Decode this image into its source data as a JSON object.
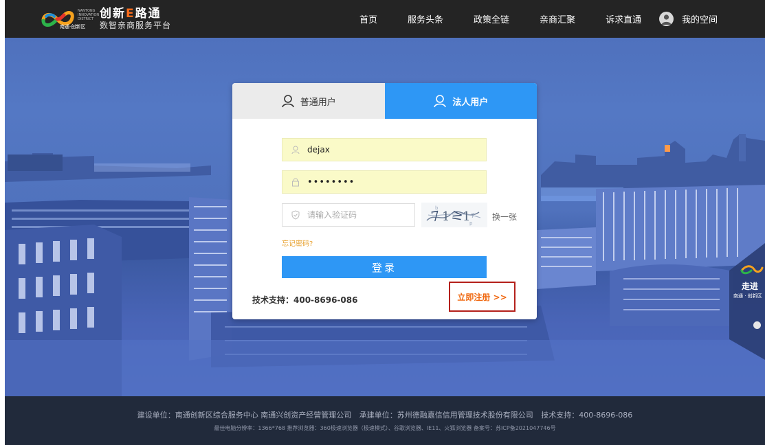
{
  "header": {
    "logo_en": "NANTONG INNOVATION DISTRICT",
    "logo_cn": "南通·创新区",
    "title_part1": "创新",
    "title_e": "E",
    "title_part2": "路通",
    "tagline": "数智亲商服务平台",
    "nav": [
      {
        "label": "首页"
      },
      {
        "label": "服务头条"
      },
      {
        "label": "政策全链"
      },
      {
        "label": "亲商汇聚"
      },
      {
        "label": "诉求直通"
      }
    ],
    "user_label": "我的空间"
  },
  "login": {
    "tabs": [
      {
        "label": "普通用户"
      },
      {
        "label": "法人用户"
      }
    ],
    "active_tab": "法人用户",
    "username_value": "dejax",
    "password_value": "••••••••",
    "captcha_placeholder": "请输入验证码",
    "refresh_label": "换一张",
    "forgot_label": "忘记密码?",
    "submit_label": "登录",
    "support_text": "技术支持：400-8696-086",
    "register_label": "立即注册 >>"
  },
  "side_float": {
    "label": "走进",
    "sub_label": "南通 · 创新区"
  },
  "footer": {
    "build_unit": "建设单位：南通创新区综合服务中心 南通兴创资产经营管理公司",
    "contractor": "承建单位：苏州德融嘉信信用管理技术股份有限公司",
    "tech_support": "技术支持：400-8696-086",
    "notice": "最佳电脑分辨率：1366*768 推荐浏览器：360极速浏览器（极速模式）、谷歌浏览器、IE11、火狐浏览器 备案号：苏ICP备2021047746号"
  },
  "colors": {
    "header_bg": "#242424",
    "accent_blue": "#2e97f5",
    "accent_orange": "#f06810",
    "register_border": "#b4201a",
    "footer_bg": "#212a3b"
  }
}
